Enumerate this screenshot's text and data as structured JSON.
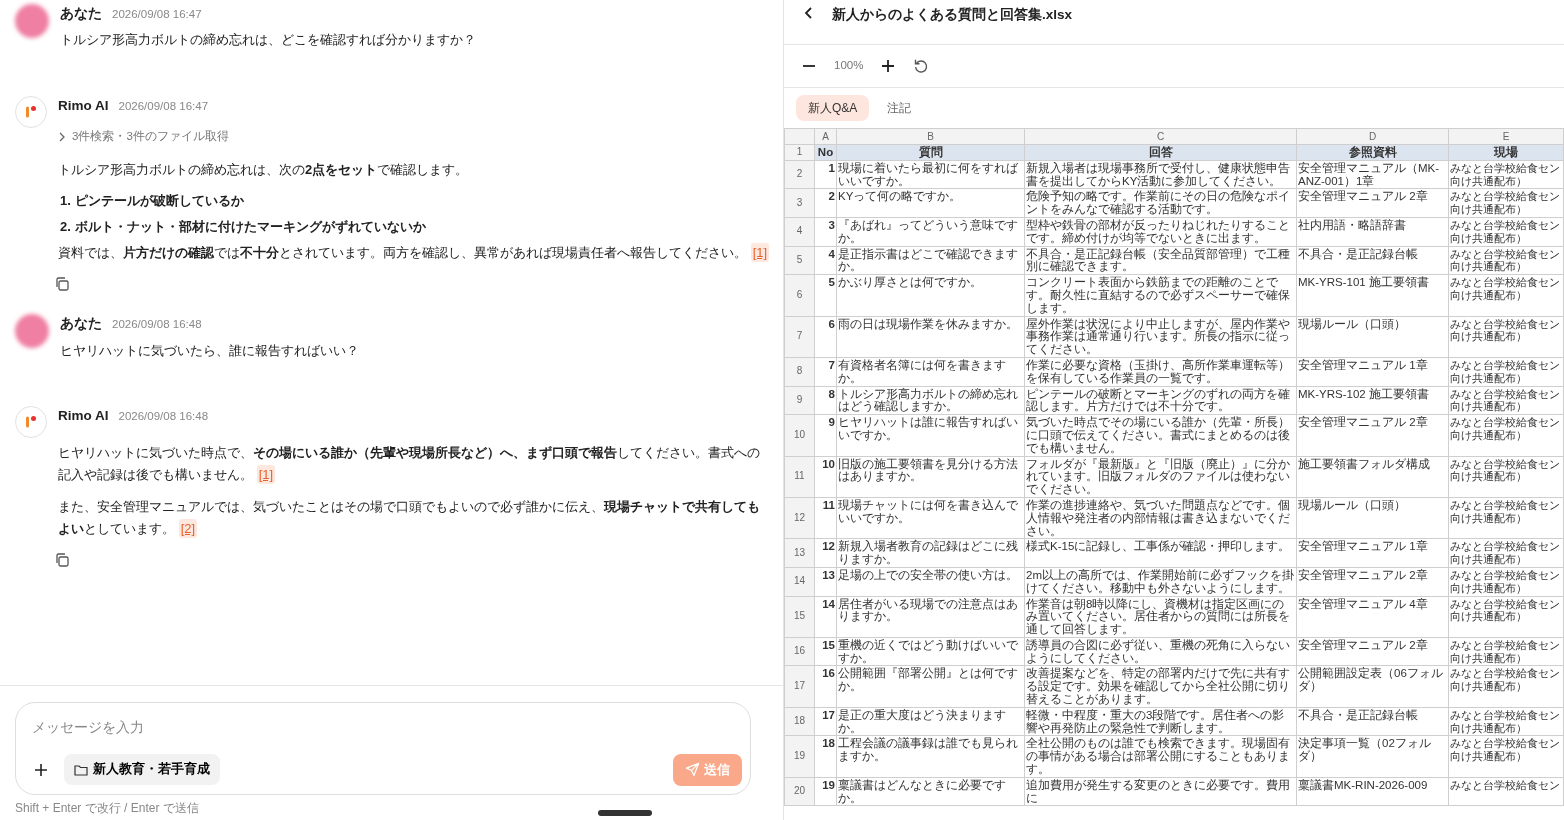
{
  "chat": {
    "messages": [
      {
        "kind": "user",
        "author": "あなた",
        "time": "2026/09/08 16:47",
        "text": "トルシア形高力ボルトの締め忘れは、どこを確認すれば分かりますか？"
      },
      {
        "kind": "ai",
        "author": "Rimo AI",
        "time": "2026/09/08 16:47",
        "steps": "3件検索・3件のファイル取得",
        "blocks": [
          {
            "kind": "p",
            "text": "トルシア形高力ボルトの締め忘れは、次の**2点をセット**で確認します。"
          },
          {
            "kind": "ol",
            "items": [
              {
                "num": "1.",
                "text": "ピンテールが破断しているか"
              },
              {
                "num": "2.",
                "text": "ボルト・ナット・部材に付けたマーキングがずれていないか"
              }
            ]
          },
          {
            "kind": "p",
            "text": "資料では、**片方だけの確認**では**不十分**とされています。両方を確認し、異常があれば現場責任者へ報告してください。",
            "cite": "[1]"
          }
        ]
      },
      {
        "kind": "user",
        "author": "あなた",
        "time": "2026/09/08 16:48",
        "text": "ヒヤリハットに気づいたら、誰に報告すればいい？"
      },
      {
        "kind": "ai",
        "author": "Rimo AI",
        "time": "2026/09/08 16:48",
        "blocks": [
          {
            "kind": "p",
            "text": "ヒヤリハットに気づいた時点で、**その場にいる誰か（先輩や現場所長など）へ、まず口頭で報告**してください。書式への記入や記録は後でも構いません。",
            "cite": "[1]"
          },
          {
            "kind": "p",
            "text": "また、安全管理マニュアルでは、気づいたことはその場で口頭でもよいので必ず誰かに伝え、**現場チャットで共有してもよい**としています。",
            "cite": "[2]"
          }
        ]
      }
    ]
  },
  "composer": {
    "placeholder": "メッセージを入力",
    "folder": "新人教育・若手育成",
    "send": "送信",
    "send_disabled": true,
    "hint": "Shift + Enter で改行 / Enter で送信"
  },
  "viewer": {
    "title": "新人からのよくある質問と回答集.xlsx",
    "zoom": "100%",
    "sheets": [
      {
        "label": "新人Q&A",
        "selected": true
      },
      {
        "label": "注記",
        "selected": false
      }
    ],
    "columns": [
      "A",
      "B",
      "C",
      "D",
      "E"
    ],
    "header": {
      "n": "1",
      "cells": [
        "No",
        "質問",
        "回答",
        "参照資料",
        "現場"
      ]
    },
    "rows": [
      {
        "n": "2",
        "no": "1",
        "q": "現場に着いたら最初に何をすればいいですか。",
        "a": "新規入場者は現場事務所で受付し、健康状態申告書を提出してからKY活動に参加してください。",
        "ref": "安全管理マニュアル（MK-ANZ-001）1章",
        "site": [
          "みなと台学校給食セン",
          "向け共通配布）"
        ]
      },
      {
        "n": "3",
        "no": "2",
        "q": "KYって何の略ですか。",
        "a": "危険予知の略です。作業前にその日の危険なポイントをみんなで確認する活動です。",
        "ref": "安全管理マニュアル 2章",
        "site": [
          "みなと台学校給食セン",
          "向け共通配布）"
        ]
      },
      {
        "n": "4",
        "no": "3",
        "q": "『あばれ』ってどういう意味ですか。",
        "a": "型枠や鉄骨の部材が反ったりねじれたりすることです。締め付けが均等でないときに出ます。",
        "ref": "社内用語・略語辞書",
        "site": [
          "みなと台学校給食セン",
          "向け共通配布）"
        ]
      },
      {
        "n": "5",
        "no": "4",
        "q": "是正指示書はどこで確認できますか。",
        "a": "不具合・是正記録台帳（安全品質部管理）で工種別に確認できます。",
        "ref": "不具合・是正記録台帳",
        "site": [
          "みなと台学校給食セン",
          "向け共通配布）"
        ]
      },
      {
        "n": "6",
        "no": "5",
        "q": "かぶり厚さとは何ですか。",
        "a": "コンクリート表面から鉄筋までの距離のことです。耐久性に直結するので必ずスペーサーで確保します。",
        "ref": "MK-YRS-101 施工要領書",
        "site": [
          "みなと台学校給食セン",
          "向け共通配布）"
        ]
      },
      {
        "n": "7",
        "no": "6",
        "q": "雨の日は現場作業を休みますか。",
        "a": "屋外作業は状況により中止しますが、屋内作業や事務作業は通常通り行います。所長の指示に従ってください。",
        "ref": "現場ルール（口頭）",
        "site": [
          "みなと台学校給食セン",
          "向け共通配布）"
        ]
      },
      {
        "n": "8",
        "no": "7",
        "q": "有資格者名簿には何を書きますか。",
        "a": "作業に必要な資格（玉掛け、高所作業車運転等）を保有している作業員の一覧です。",
        "ref": "安全管理マニュアル 1章",
        "site": [
          "みなと台学校給食セン",
          "向け共通配布）"
        ]
      },
      {
        "n": "9",
        "no": "8",
        "q": "トルシア形高力ボルトの締め忘れはどう確認しますか。",
        "a": "ピンテールの破断とマーキングのずれの両方を確認します。片方だけでは不十分です。",
        "ref": "MK-YRS-102 施工要領書",
        "site": [
          "みなと台学校給食セン",
          "向け共通配布）"
        ]
      },
      {
        "n": "10",
        "no": "9",
        "q": "ヒヤリハットは誰に報告すればいいですか。",
        "a": "気づいた時点でその場にいる誰か（先輩・所長）に口頭で伝えてください。書式にまとめるのは後でも構いません。",
        "ref": "安全管理マニュアル 2章",
        "site": [
          "みなと台学校給食セン",
          "向け共通配布）"
        ]
      },
      {
        "n": "11",
        "no": "10",
        "q": "旧版の施工要領書を見分ける方法はありますか。",
        "a": "フォルダが『最新版』と『旧版（廃止）』に分かれています。旧版フォルダのファイルは使わないでください。",
        "ref": "施工要領書フォルダ構成",
        "site": [
          "みなと台学校給食セン",
          "向け共通配布）"
        ]
      },
      {
        "n": "12",
        "no": "11",
        "q": "現場チャットには何を書き込んでいいですか。",
        "a": "作業の進捗連絡や、気づいた問題点などです。個人情報や発注者の内部情報は書き込まないでください。",
        "ref": "現場ルール（口頭）",
        "site": [
          "みなと台学校給食セン",
          "向け共通配布）"
        ]
      },
      {
        "n": "13",
        "no": "12",
        "q": "新規入場者教育の記録はどこに残りますか。",
        "a": "様式K-15に記録し、工事係が確認・押印します。",
        "ref": "安全管理マニュアル 1章",
        "site": [
          "みなと台学校給食セン",
          "向け共通配布）"
        ]
      },
      {
        "n": "14",
        "no": "13",
        "q": "足場の上での安全帯の使い方は。",
        "a": "2m以上の高所では、作業開始前に必ずフックを掛けてください。移動中も外さないようにします。",
        "ref": "安全管理マニュアル 2章",
        "site": [
          "みなと台学校給食セン",
          "向け共通配布）"
        ]
      },
      {
        "n": "15",
        "no": "14",
        "q": "居住者がいる現場での注意点はありますか。",
        "a": "作業音は朝8時以降にし、資機材は指定区画にのみ置いてください。居住者からの質問には所長を通して回答します。",
        "ref": "安全管理マニュアル 4章",
        "site": [
          "みなと台学校給食セン",
          "向け共通配布）"
        ]
      },
      {
        "n": "16",
        "no": "15",
        "q": "重機の近くではどう動けばいいですか。",
        "a": "誘導員の合図に必ず従い、重機の死角に入らないようにしてください。",
        "ref": "安全管理マニュアル 2章",
        "site": [
          "みなと台学校給食セン",
          "向け共通配布）"
        ]
      },
      {
        "n": "17",
        "no": "16",
        "q": "公開範囲『部署公開』とは何ですか。",
        "a": "改善提案などを、特定の部署内だけで先に共有する設定です。効果を確認してから全社公開に切り替えることがあります。",
        "ref": "公開範囲設定表（06フォルダ）",
        "site": [
          "みなと台学校給食セン",
          "向け共通配布）"
        ]
      },
      {
        "n": "18",
        "no": "17",
        "q": "是正の重大度はどう決まりますか。",
        "a": "軽微・中程度・重大の3段階です。居住者への影響や再発防止の緊急性で判断します。",
        "ref": "不具合・是正記録台帳",
        "site": [
          "みなと台学校給食セン",
          "向け共通配布）"
        ]
      },
      {
        "n": "19",
        "no": "18",
        "q": "工程会議の議事録は誰でも見られますか。",
        "a": "全社公開のものは誰でも検索できます。現場固有の事情がある場合は部署公開にすることもあります。",
        "ref": "決定事項一覧（02フォルダ）",
        "site": [
          "みなと台学校給食セン",
          "向け共通配布）"
        ]
      },
      {
        "n": "20",
        "no": "19",
        "q": "稟議書はどんなときに必要ですか。",
        "a": "追加費用が発生する変更のときに必要です。費用に",
        "ref": "稟議書MK-RIN-2026-009",
        "site": [
          "みなと台学校給食セン"
        ]
      }
    ]
  }
}
